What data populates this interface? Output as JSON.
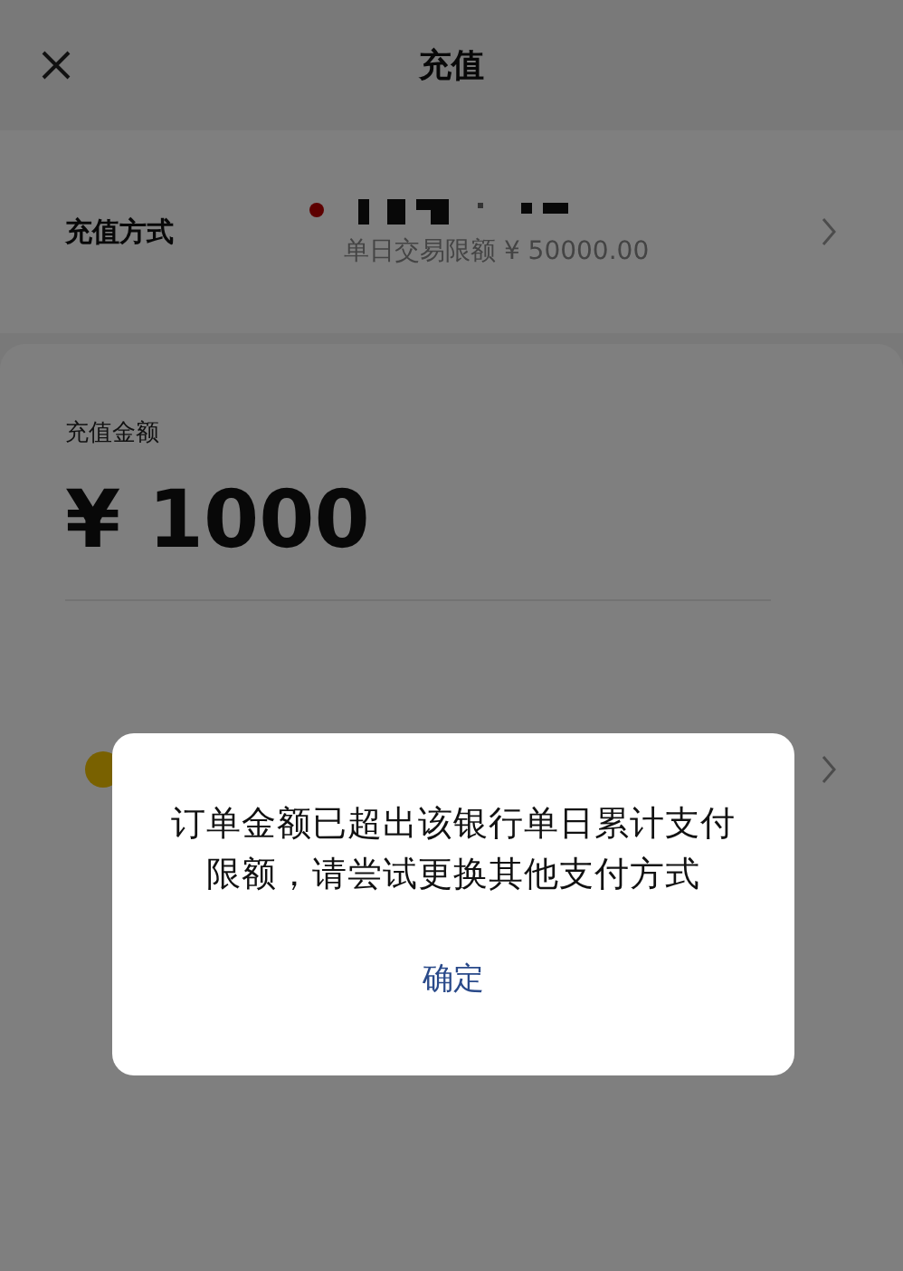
{
  "header": {
    "title": "充值"
  },
  "method": {
    "label": "充值方式",
    "limit": "单日交易限额 ¥ 50000.00"
  },
  "amount": {
    "label": "充值金额",
    "value": "¥ 1000"
  },
  "dialog": {
    "message": "订单金额已超出该银行单日累计支付限额，请尝试更换其他支付方式",
    "button": "确定"
  }
}
